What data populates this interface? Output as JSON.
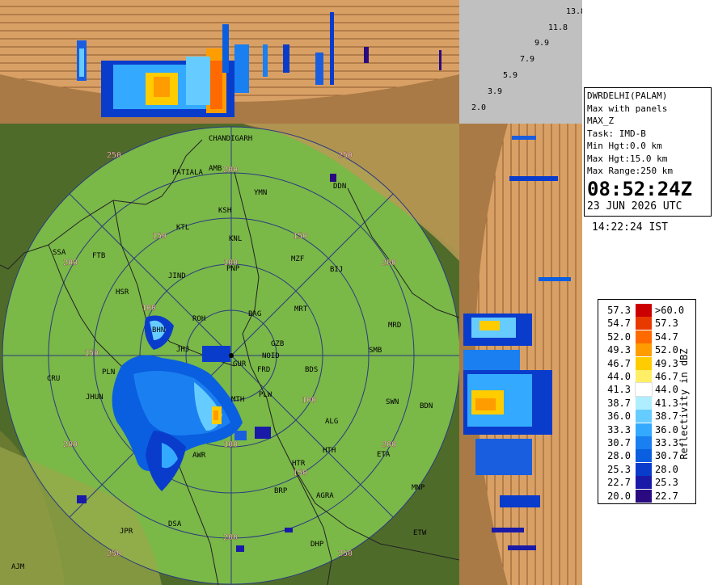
{
  "station": {
    "name": "DWRDELHI(PALAM)",
    "product": "Max with panels",
    "product_code": "MAX_Z",
    "task": "Task: IMD-B",
    "min_hgt": "Min Hgt:0.0 km",
    "max_hgt": "Max Hgt:15.0 km",
    "max_range": "Max Range:250 km",
    "time_utc": "08:52:24Z",
    "date_utc": "23 JUN 2026 UTC",
    "time_ist": "14:22:24 IST"
  },
  "height_labels": [
    "13.8",
    "11.8",
    "9.9",
    "7.9",
    "5.9",
    "3.9",
    "2.0"
  ],
  "legend": {
    "title": "Reflectivity in dBZ",
    "rows": [
      {
        "lo": "57.3",
        "hi": ">60.0",
        "color": "#cc0000"
      },
      {
        "lo": "54.7",
        "hi": "57.3",
        "color": "#e83a00"
      },
      {
        "lo": "52.0",
        "hi": "54.7",
        "color": "#ff6a00"
      },
      {
        "lo": "49.3",
        "hi": "52.0",
        "color": "#ff9c00"
      },
      {
        "lo": "46.7",
        "hi": "49.3",
        "color": "#ffcc00"
      },
      {
        "lo": "44.0",
        "hi": "46.7",
        "color": "#ffee66"
      },
      {
        "lo": "41.3",
        "hi": "44.0",
        "color": "#ffffff"
      },
      {
        "lo": "38.7",
        "hi": "41.3",
        "color": "#aeeeff"
      },
      {
        "lo": "36.0",
        "hi": "38.7",
        "color": "#66ccff"
      },
      {
        "lo": "33.3",
        "hi": "36.0",
        "color": "#33aaff"
      },
      {
        "lo": "30.7",
        "hi": "33.3",
        "color": "#1a7ff0"
      },
      {
        "lo": "28.0",
        "hi": "30.7",
        "color": "#0a5ee0"
      },
      {
        "lo": "25.3",
        "hi": "28.0",
        "color": "#0a3ccc"
      },
      {
        "lo": "22.7",
        "hi": "25.3",
        "color": "#1a1aa8"
      },
      {
        "lo": "20.0",
        "hi": "22.7",
        "color": "#2a0a80"
      }
    ]
  },
  "map": {
    "range_rings_km": [
      50,
      100,
      150,
      200,
      250
    ],
    "range_labels": [
      {
        "text": "250",
        "ref": "ring-250-nw"
      },
      {
        "text": "250",
        "ref": "ring-250-ne"
      },
      {
        "text": "250",
        "ref": "ring-250-sw"
      },
      {
        "text": "250",
        "ref": "ring-250-se"
      },
      {
        "text": "200",
        "ref": "ring-200-n"
      },
      {
        "text": "200",
        "ref": "ring-200-w"
      },
      {
        "text": "200",
        "ref": "ring-200-e"
      },
      {
        "text": "200",
        "ref": "ring-200-sw"
      },
      {
        "text": "200",
        "ref": "ring-200-se"
      },
      {
        "text": "200",
        "ref": "ring-200-s"
      },
      {
        "text": "150",
        "ref": "ring-150-nw"
      },
      {
        "text": "150",
        "ref": "ring-150-ne"
      },
      {
        "text": "150",
        "ref": "ring-150-w"
      },
      {
        "text": "150",
        "ref": "ring-150-s"
      },
      {
        "text": "100",
        "ref": "ring-100-n"
      },
      {
        "text": "100",
        "ref": "ring-100-w"
      },
      {
        "text": "100",
        "ref": "ring-100-e"
      },
      {
        "text": "100",
        "ref": "ring-100-s"
      }
    ],
    "cities": [
      "CHANDIGARH",
      "PATIALA",
      "AMB",
      "YMN",
      "DDN",
      "KSH",
      "KTL",
      "KNL",
      "SSA",
      "FTB",
      "JIND",
      "PNP",
      "MZF",
      "BIJ",
      "HSR",
      "ROH",
      "BAG",
      "MRT",
      "MRD",
      "BHN",
      "JHJ",
      "GZB",
      "NOID",
      "SMB",
      "CRU",
      "PLN",
      "GUR",
      "FRD",
      "BDS",
      "JHUN",
      "PLW",
      "MTH",
      "SWN",
      "BDN",
      "ALG",
      "HTH",
      "ETA",
      "AWR",
      "HTR",
      "BRP",
      "AGRA",
      "MNP",
      "DSA",
      "JPR",
      "DHP",
      "ETW",
      "AJM"
    ]
  }
}
